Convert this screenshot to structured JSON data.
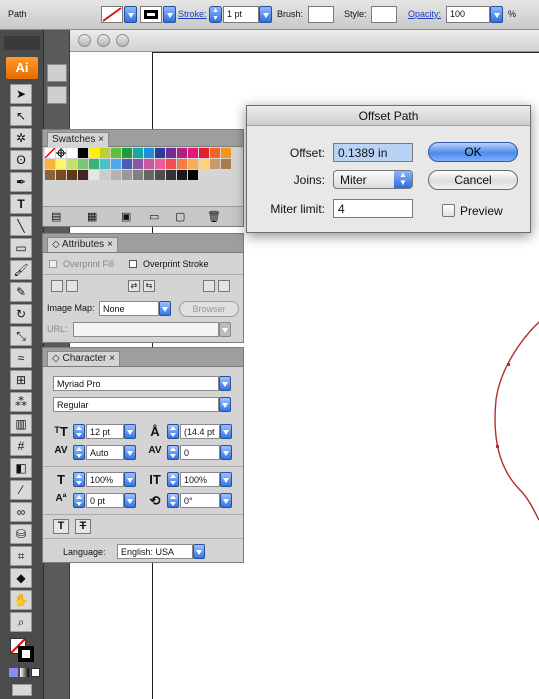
{
  "control_bar": {
    "label": "Path",
    "stroke_label": "Stroke:",
    "stroke_value": "1 pt",
    "brush_label": "Brush:",
    "style_label": "Style:",
    "opacity_label": "Opacity:",
    "opacity_value": "100",
    "opacity_unit": "%"
  },
  "tools_panel": {
    "logo": "Ai"
  },
  "swatches": {
    "tab": "Swatches",
    "colors": [
      "#ffffff",
      "#000000",
      "#fff200",
      "#b8d32d",
      "#5fbf3a",
      "#1a9c3f",
      "#1ba7a1",
      "#1f8fdd",
      "#2f3b9c",
      "#6f2c91",
      "#b0207e",
      "#e4147a",
      "#e0202e",
      "#f26522",
      "#f7941e",
      "#fbb040",
      "#fff568",
      "#c5e06a",
      "#7cc576",
      "#3cb371",
      "#48c3c8",
      "#52a7e8",
      "#4b5bb7",
      "#8a57a8",
      "#c65ba2",
      "#ee5a9c",
      "#ef4f51",
      "#f47d4a",
      "#f9ad5b",
      "#ffd37a",
      "#c69c6d",
      "#a67c52",
      "#8c6239",
      "#754c24",
      "#603913",
      "#3e2723",
      "#e6e6e6",
      "#cccccc",
      "#b3b3b3",
      "#999999",
      "#808080",
      "#666666",
      "#4d4d4d",
      "#333333",
      "#1a1a1a",
      "#000000"
    ]
  },
  "attributes": {
    "tab": "Attributes",
    "overprint_fill": "Overprint Fill",
    "overprint_stroke": "Overprint Stroke",
    "image_map_label": "Image Map:",
    "image_map_value": "None",
    "browser_button": "Browser",
    "url_label": "URL:"
  },
  "character": {
    "tab": "Character",
    "font_family": "Myriad Pro",
    "font_style": "Regular",
    "font_size": "12 pt",
    "leading": "(14.4 pt",
    "kerning": "Auto",
    "tracking": "0",
    "vertical_scale": "100%",
    "horizontal_scale": "100%",
    "baseline_shift": "0 pt",
    "rotation": "0°",
    "language_label": "Language:",
    "language_value": "English: USA"
  },
  "offset_path_dialog": {
    "title": "Offset Path",
    "offset_label": "Offset:",
    "offset_value": "0.1389 in",
    "joins_label": "Joins:",
    "joins_value": "Miter",
    "miter_limit_label": "Miter limit:",
    "miter_limit_value": "4",
    "ok_button": "OK",
    "cancel_button": "Cancel",
    "preview_label": "Preview",
    "preview_checked": false
  },
  "colors": {
    "path_stroke": "#b03030",
    "ai_accent": "#f08a14",
    "primary_button": "#5d95e8"
  }
}
